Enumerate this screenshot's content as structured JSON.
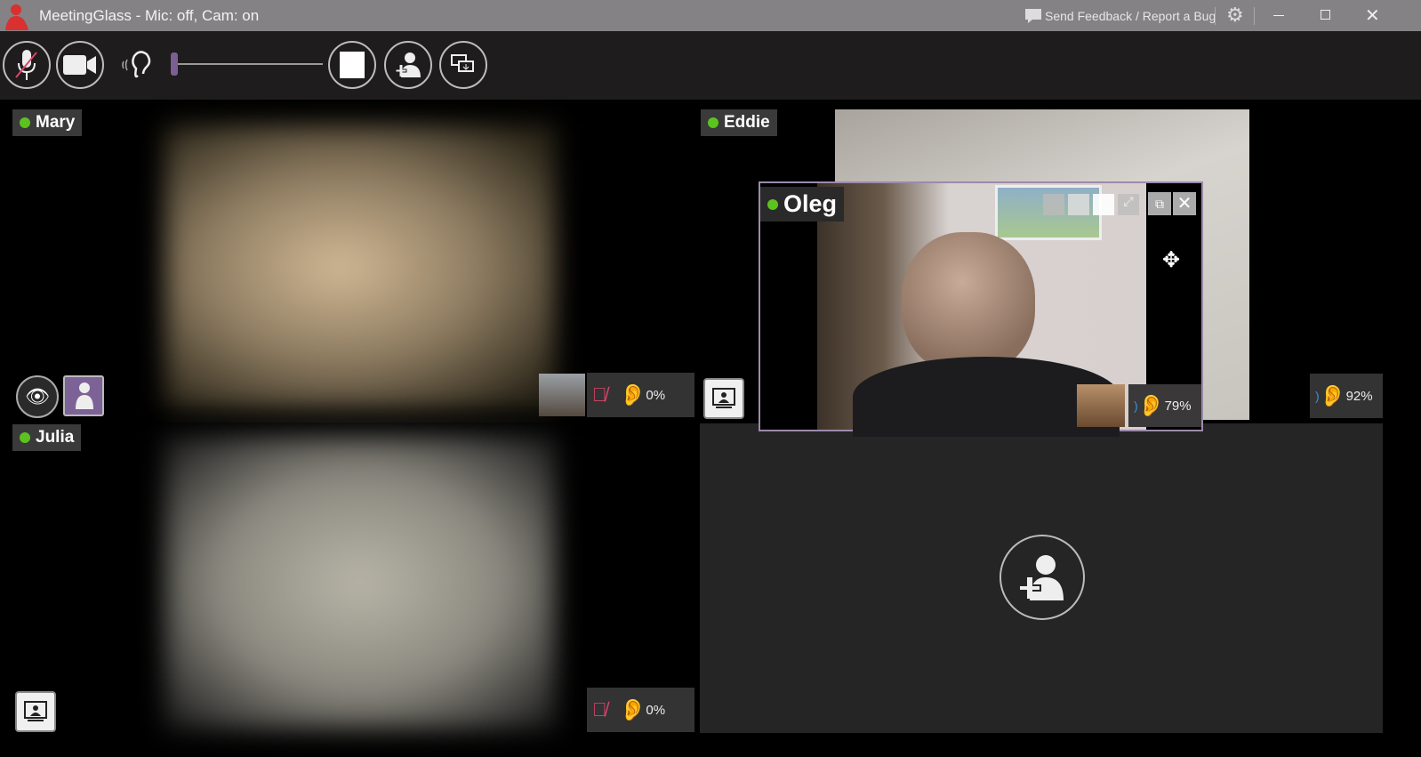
{
  "window": {
    "title": "MeetingGlass - Mic: off, Cam: on",
    "feedback": "Send Feedback / Report a Bug"
  },
  "toolbar": {
    "mic": "mic-off",
    "cam": "camera-on",
    "volume": 0,
    "icons": [
      "stop",
      "add-participant",
      "screen-share"
    ]
  },
  "participants": [
    {
      "name": "Mary",
      "volume": "0%",
      "mic": "muted"
    },
    {
      "name": "Julia",
      "volume": "0%",
      "mic": "muted"
    },
    {
      "name": "Eddie",
      "volume": "92%"
    },
    {
      "name": "Oleg",
      "volume": "79%"
    }
  ],
  "colors": {
    "online": "#5cc21f",
    "accent": "#8a6aa0"
  }
}
